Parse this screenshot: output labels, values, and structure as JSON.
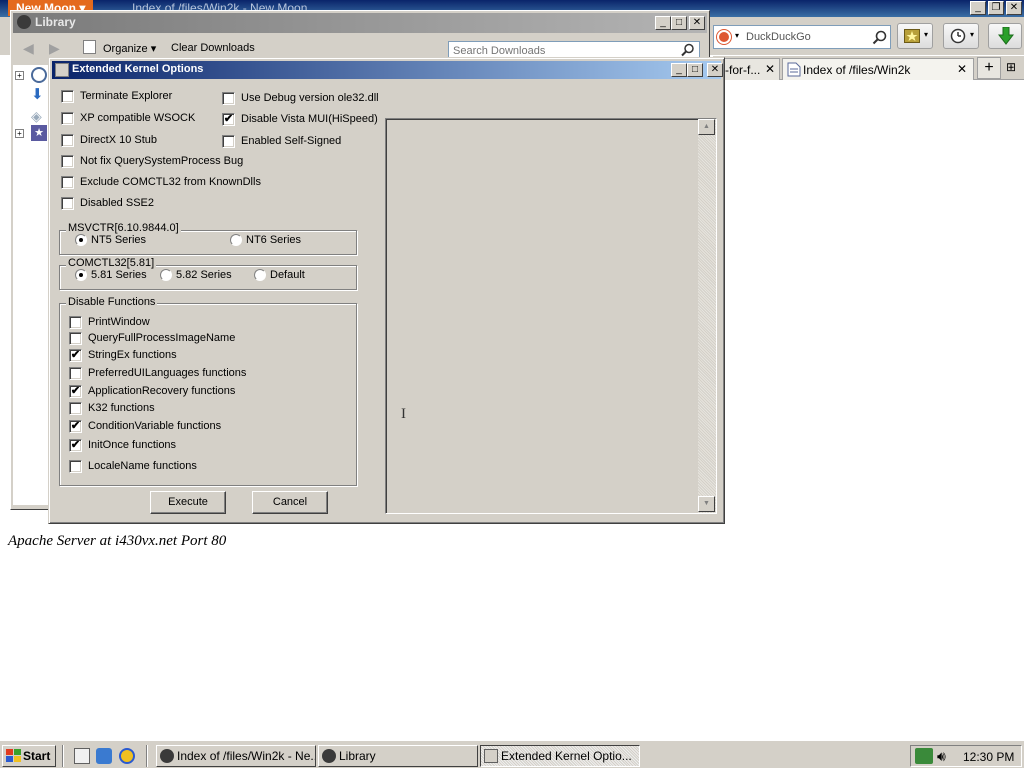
{
  "browser": {
    "app_menu": "New Moon",
    "window_title": "Index of /files/Win2k - New Moon",
    "search_engine": "DuckDuckGo",
    "tabs": [
      {
        "label": "-for-f..."
      },
      {
        "label": "Index of /files/Win2k"
      }
    ],
    "page_footer": "Apache Server at i430vx.net Port 80"
  },
  "library": {
    "title": "Library",
    "organize_label": "Organize",
    "clear_downloads_label": "Clear Downloads",
    "search_placeholder": "Search Downloads"
  },
  "kernel_options": {
    "title": "Extended Kernel Options",
    "left_checkboxes": [
      {
        "label": "Terminate Explorer",
        "checked": false
      },
      {
        "label": "XP compatible WSOCK",
        "checked": false
      },
      {
        "label": "DirectX 10 Stub",
        "checked": false
      },
      {
        "label": "Not fix QuerySystemProcess Bug",
        "checked": false
      },
      {
        "label": "Exclude COMCTL32 from KnownDlls",
        "checked": false
      },
      {
        "label": "Disabled SSE2",
        "checked": false
      }
    ],
    "right_checkboxes": [
      {
        "label": "Use Debug version ole32.dll",
        "checked": false
      },
      {
        "label": "Disable Vista MUI(HiSpeed)",
        "checked": true
      },
      {
        "label": "Enabled Self-Signed",
        "checked": false
      }
    ],
    "msvctr": {
      "title": "MSVCTR[6.10.9844.0]",
      "options": [
        {
          "label": "NT5 Series",
          "selected": true
        },
        {
          "label": "NT6 Series",
          "selected": false
        }
      ]
    },
    "comctl": {
      "title": "COMCTL32[5.81]",
      "options": [
        {
          "label": "5.81 Series",
          "selected": true
        },
        {
          "label": "5.82 Series",
          "selected": false
        },
        {
          "label": "Default",
          "selected": false
        }
      ]
    },
    "disable_functions": {
      "title": "Disable Functions",
      "items": [
        {
          "label": "PrintWindow",
          "checked": false
        },
        {
          "label": "QueryFullProcessImageName",
          "checked": false
        },
        {
          "label": "StringEx functions",
          "checked": true
        },
        {
          "label": "PreferredUILanguages functions",
          "checked": false
        },
        {
          "label": "ApplicationRecovery functions",
          "checked": true
        },
        {
          "label": "K32 functions",
          "checked": false
        },
        {
          "label": "ConditionVariable functions",
          "checked": true
        },
        {
          "label": "InitOnce functions",
          "checked": true
        },
        {
          "label": "LocaleName functions",
          "checked": false
        }
      ]
    },
    "execute_label": "Execute",
    "cancel_label": "Cancel"
  },
  "taskbar": {
    "start_label": "Start",
    "tasks": [
      {
        "label": "Index of /files/Win2k - Ne...",
        "active": false
      },
      {
        "label": "Library",
        "active": false
      },
      {
        "label": "Extended Kernel Optio...",
        "active": true
      }
    ],
    "clock": "12:30 PM"
  },
  "check_mark": "✔"
}
